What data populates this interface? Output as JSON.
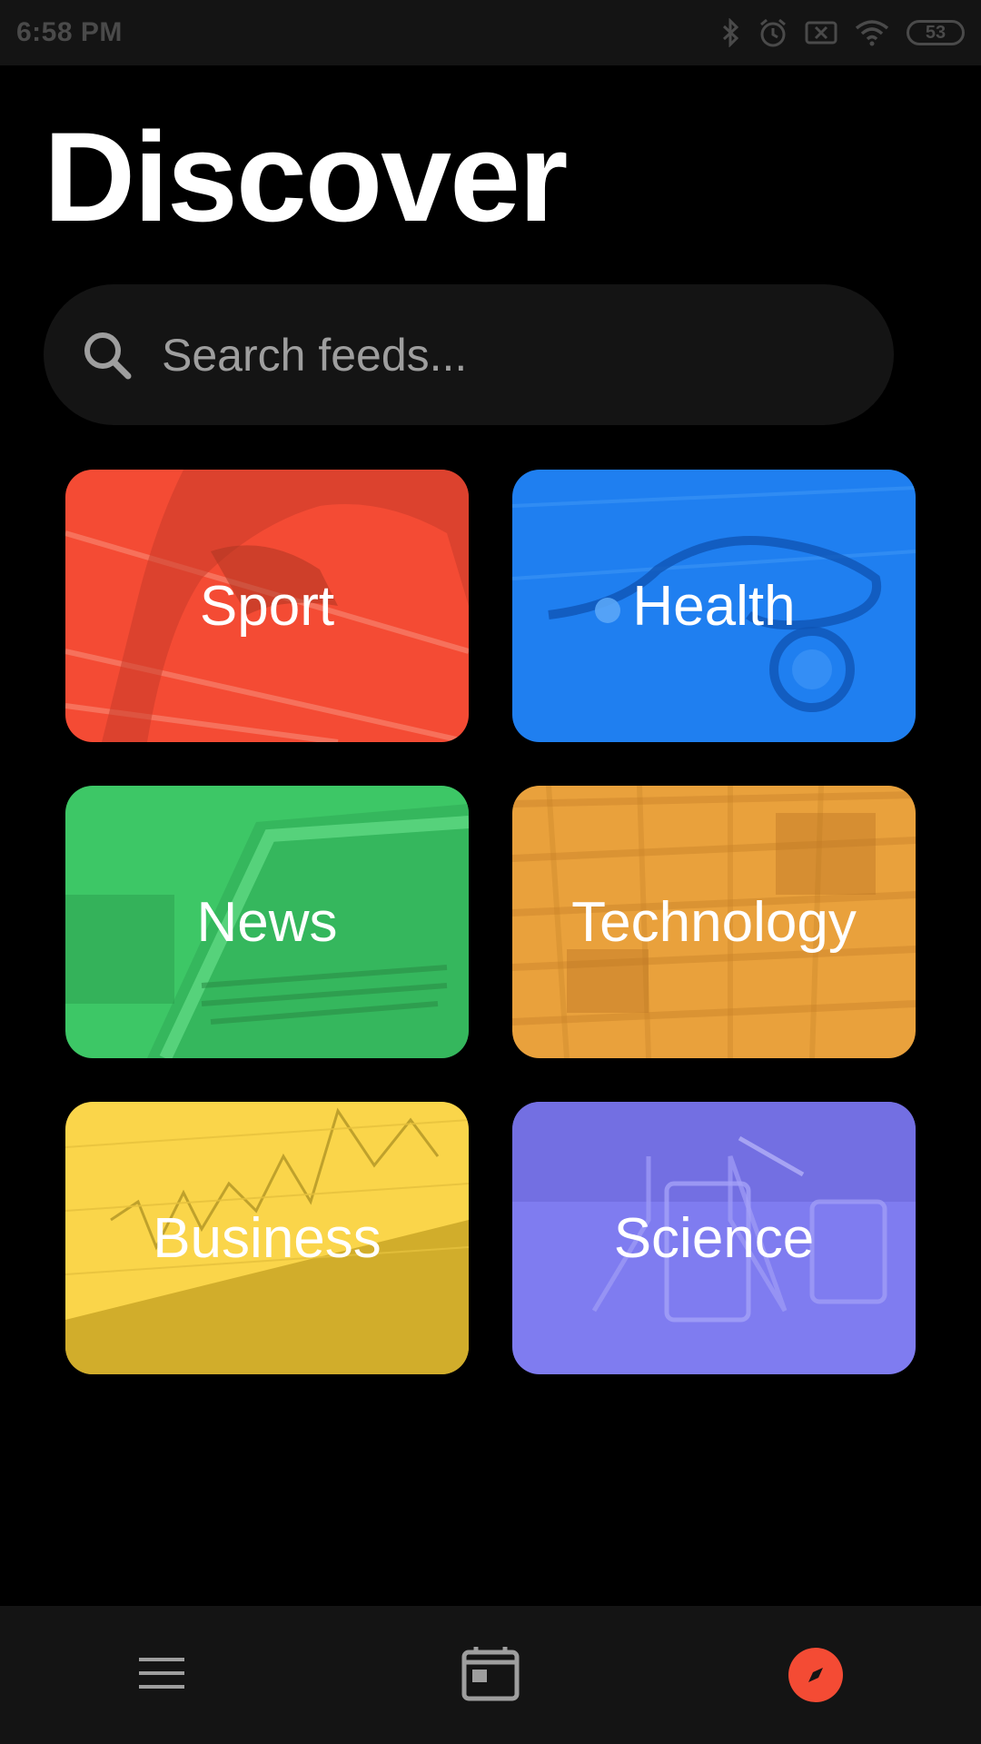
{
  "status_bar": {
    "time": "6:58 PM",
    "battery": "53"
  },
  "page": {
    "title": "Discover"
  },
  "search": {
    "placeholder": "Search feeds..."
  },
  "categories": [
    {
      "label": "Sport",
      "color": "#f44b34"
    },
    {
      "label": "Health",
      "color": "#1f7ff0"
    },
    {
      "label": "News",
      "color": "#3dc766"
    },
    {
      "label": "Technology",
      "color": "#e9a13c"
    },
    {
      "label": "Business",
      "color": "#fad54a"
    },
    {
      "label": "Science",
      "color": "#7f7cf0"
    }
  ],
  "bottom_nav": {
    "items": [
      {
        "icon": "hamburger-menu-icon"
      },
      {
        "icon": "feed-icon"
      },
      {
        "icon": "compass-icon",
        "active": true
      }
    ],
    "accent": "#f44b34"
  }
}
